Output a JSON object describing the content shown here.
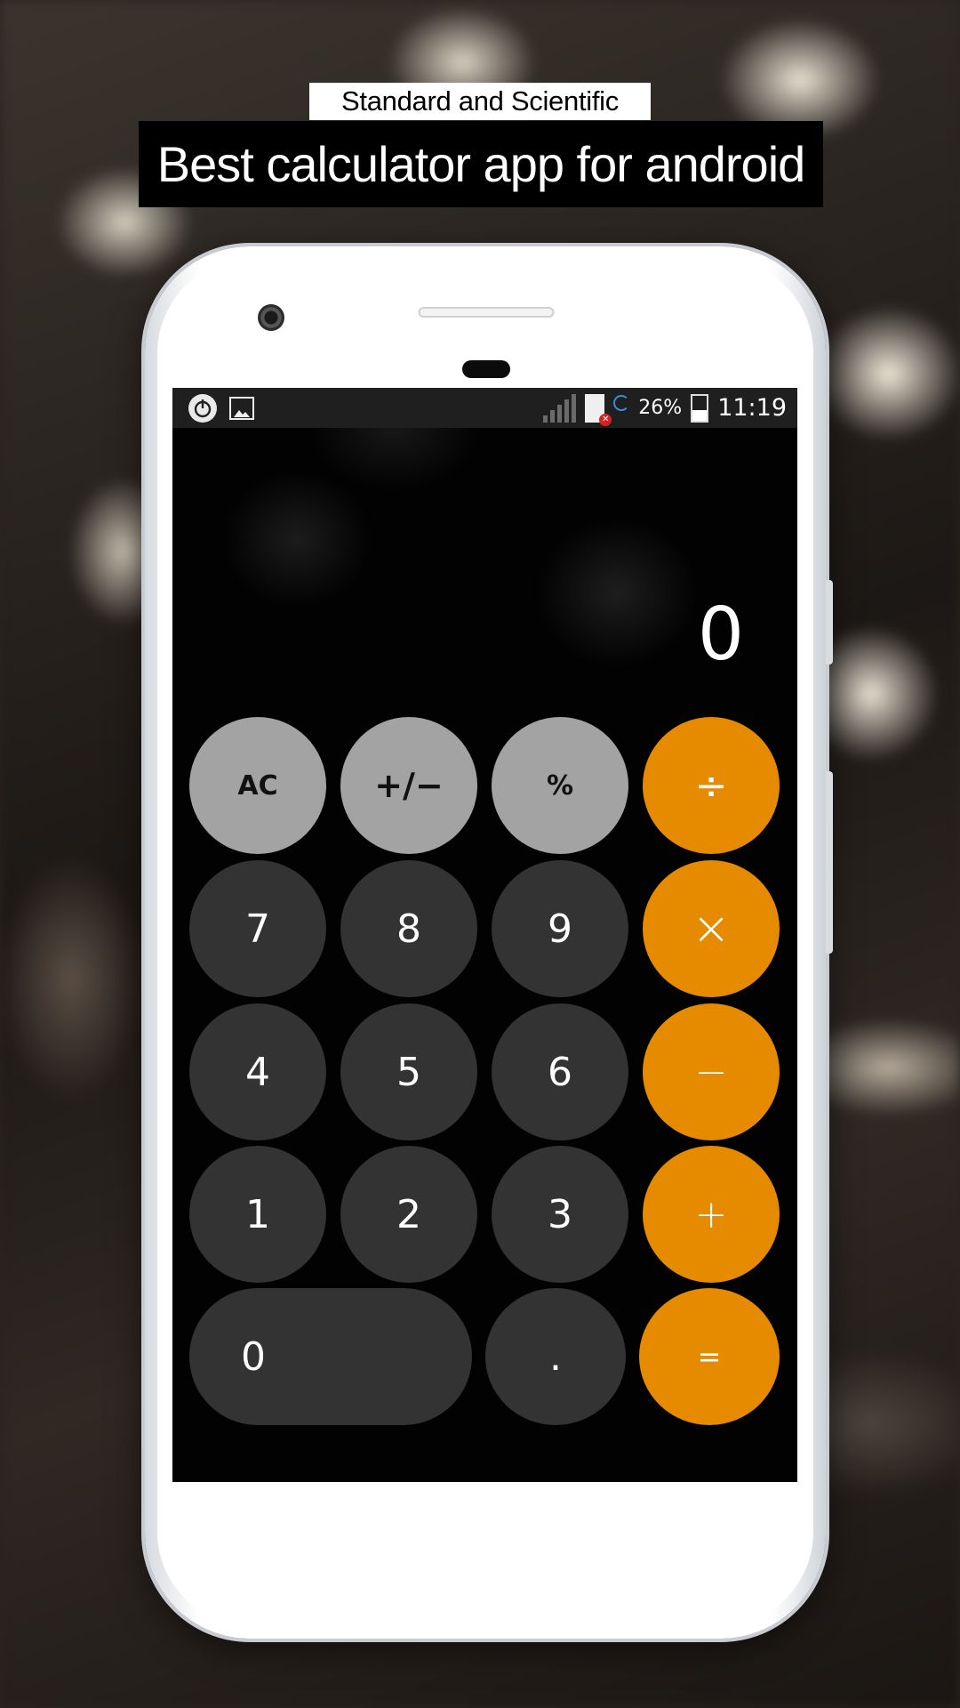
{
  "promo": {
    "subtitle": "Standard and Scientific",
    "title": "Best calculator app for android"
  },
  "statusbar": {
    "battery_percent": "26%",
    "time": "11:19",
    "icons": [
      "power-icon",
      "image-icon",
      "signal-icon",
      "sim-error-icon",
      "sync-icon",
      "battery-icon"
    ]
  },
  "calculator": {
    "display": "0",
    "keys": {
      "ac": "AC",
      "plus_minus": "+∕−",
      "percent": "%",
      "divide": "÷",
      "seven": "7",
      "eight": "8",
      "nine": "9",
      "multiply": "×",
      "four": "4",
      "five": "5",
      "six": "6",
      "minus": "−",
      "one": "1",
      "two": "2",
      "three": "3",
      "plus": "+",
      "zero": "0",
      "decimal": ".",
      "equals": "="
    },
    "colors": {
      "function_key": "#a3a3a3",
      "digit_key": "#333333",
      "operator_key": "#e68a00",
      "background": "#000000"
    }
  }
}
